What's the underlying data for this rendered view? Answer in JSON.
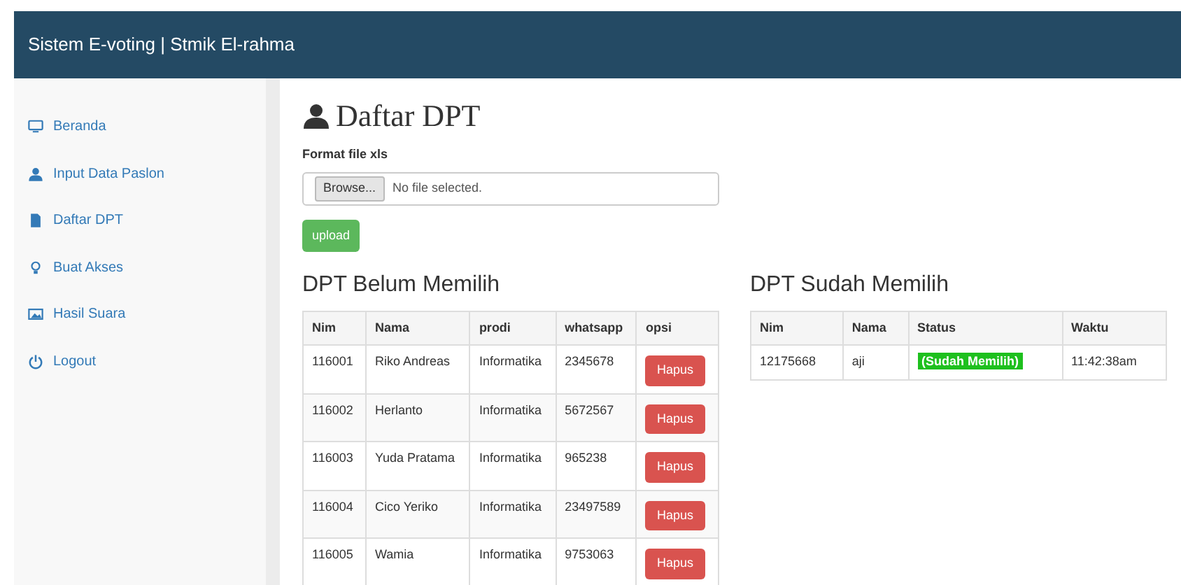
{
  "navbar": {
    "brand": "Sistem E-voting | Stmik El-rahma"
  },
  "sidebar": {
    "items": [
      {
        "label": "Beranda"
      },
      {
        "label": "Input Data Paslon"
      },
      {
        "label": "Daftar DPT"
      },
      {
        "label": "Buat Akses"
      },
      {
        "label": "Hasil Suara"
      },
      {
        "label": "Logout"
      }
    ]
  },
  "page": {
    "title": "Daftar DPT",
    "upload_label": "Format file xls",
    "browse_button": "Browse...",
    "file_status": "No file selected.",
    "upload_button": "upload"
  },
  "belum": {
    "title": "DPT Belum Memilih",
    "columns": [
      "Nim",
      "Nama",
      "prodi",
      "whatsapp",
      "opsi"
    ],
    "rows": [
      {
        "nim": "116001",
        "nama": "Riko Andreas",
        "prodi": "Informatika",
        "whatsapp": "2345678",
        "action": "Hapus"
      },
      {
        "nim": "116002",
        "nama": "Herlanto",
        "prodi": "Informatika",
        "whatsapp": "5672567",
        "action": "Hapus"
      },
      {
        "nim": "116003",
        "nama": "Yuda Pratama",
        "prodi": "Informatika",
        "whatsapp": "965238",
        "action": "Hapus"
      },
      {
        "nim": "116004",
        "nama": "Cico Yeriko",
        "prodi": "Informatika",
        "whatsapp": "23497589",
        "action": "Hapus"
      },
      {
        "nim": "116005",
        "nama": "Wamia",
        "prodi": "Informatika",
        "whatsapp": "9753063",
        "action": "Hapus"
      }
    ]
  },
  "sudah": {
    "title": "DPT Sudah Memilih",
    "columns": [
      "Nim",
      "Nama",
      "Status",
      "Waktu"
    ],
    "rows": [
      {
        "nim": "12175668",
        "nama": "aji",
        "status": "(Sudah Memilih)",
        "waktu": "11:42:38am"
      }
    ]
  }
}
